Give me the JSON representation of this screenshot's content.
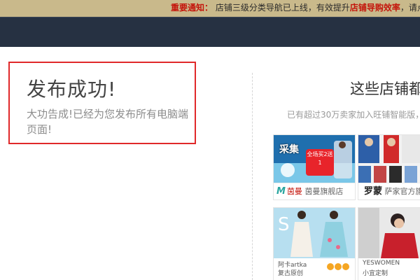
{
  "notice": {
    "label": "重要通知：",
    "text": "店铺三级分类导航已上线，有效提升",
    "highlight": "店铺导购效率",
    "tail": "，请点"
  },
  "success": {
    "title": "发布成功!",
    "message": "大功告成!已经为您发布所有电脑端页面!"
  },
  "promo": {
    "title": "这些店铺都",
    "subtitle": "已有超过30万卖家加入旺铺智能版，"
  },
  "stores": [
    {
      "tag": "采集",
      "badge": "全场买2送1",
      "logo": "M",
      "logo_cn": "茵曼",
      "name": "茵曼旗舰店"
    },
    {
      "logo": "罗蒙",
      "name": "萨家官方旗"
    },
    {
      "line1": "阿卡artka",
      "line2": "复古原创"
    },
    {
      "line1": "YESWOMEN",
      "line2": "小宜定制"
    }
  ],
  "colors": {
    "notice_bg": "#c9b98b",
    "nav_bg": "#263142",
    "highlight_border": "#e0292a",
    "accent_red": "#c4150b"
  }
}
